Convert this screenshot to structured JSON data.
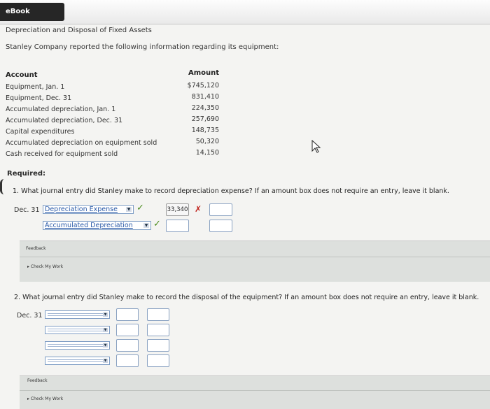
{
  "topbar": {
    "tab_label": "eBook"
  },
  "page": {
    "title": "Depreciation and Disposal of Fixed Assets",
    "intro": "Stanley Company reported the following information regarding its equipment:"
  },
  "table": {
    "headers": [
      "Account",
      "Amount"
    ],
    "rows": [
      {
        "label": "Equipment, Jan. 1",
        "value": "$745,120"
      },
      {
        "label": "Equipment, Dec. 31",
        "value": "831,410"
      },
      {
        "label": "Accumulated depreciation, Jan. 1",
        "value": "224,350"
      },
      {
        "label": "Accumulated depreciation, Dec. 31",
        "value": "257,690"
      },
      {
        "label": "Capital expenditures",
        "value": "148,735"
      },
      {
        "label": "Accumulated depreciation on equipment sold",
        "value": "50,320"
      },
      {
        "label": "Cash received for equipment sold",
        "value": "14,150"
      }
    ]
  },
  "required": "Required:",
  "q1": {
    "prompt": "1.  What journal entry did Stanley make to record depreciation expense? If an amount box does not require an entry, leave it blank.",
    "date": "Dec. 31",
    "rows": [
      {
        "account": "Depreciation Expense",
        "debit": "33,340",
        "credit": ""
      },
      {
        "account": "Accumulated Depreciation",
        "debit": "",
        "credit": ""
      }
    ],
    "correct_mark": "✓",
    "wrong_mark": "✗"
  },
  "feedback1": {
    "label": "Feedback",
    "check": "▸ Check My Work"
  },
  "q2": {
    "prompt": "2.  What journal entry did Stanley make to record the disposal of the equipment? If an amount box does not require an entry, leave it blank.",
    "date": "Dec. 31"
  },
  "feedback2": {
    "label": "Feedback",
    "check": "▸ Check My Work"
  }
}
